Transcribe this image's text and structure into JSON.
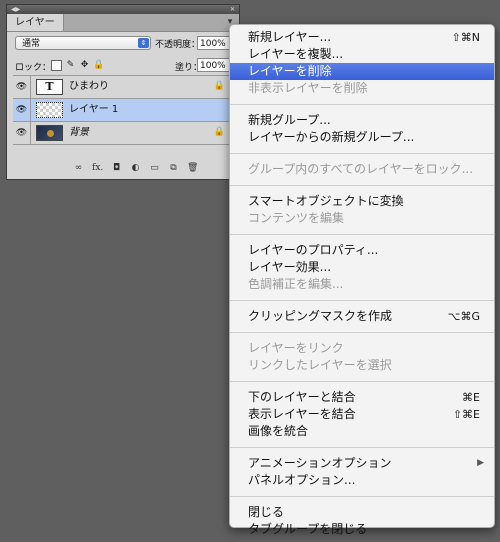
{
  "panel": {
    "tab_label": "レイヤー",
    "menu_button": "▾",
    "blend_mode": "通常",
    "opacity_label": "不透明度：",
    "opacity_value": "100%",
    "lock_label": "ロック：",
    "fill_label": "塗り：",
    "fill_value": "100%",
    "layers": [
      {
        "name": "ひまわり",
        "thumb": "T"
      },
      {
        "name": "レイヤー 1",
        "thumb": ""
      },
      {
        "name": "背景",
        "thumb": ""
      }
    ],
    "footer_fx": "fx."
  },
  "menu": {
    "items": [
      {
        "label": "新規レイヤー...",
        "shortcut": "⇧⌘N"
      },
      {
        "label": "レイヤーを複製..."
      },
      {
        "label": "レイヤーを削除"
      },
      {
        "label": "非表示レイヤーを削除"
      },
      {
        "label": "新規グループ..."
      },
      {
        "label": "レイヤーからの新規グループ..."
      },
      {
        "label": "グループ内のすべてのレイヤーをロック..."
      },
      {
        "label": "スマートオブジェクトに変換"
      },
      {
        "label": "コンテンツを編集"
      },
      {
        "label": "レイヤーのプロパティ..."
      },
      {
        "label": "レイヤー効果..."
      },
      {
        "label": "色調補正を編集..."
      },
      {
        "label": "クリッピングマスクを作成",
        "shortcut": "⌥⌘G"
      },
      {
        "label": "レイヤーをリンク"
      },
      {
        "label": "リンクしたレイヤーを選択"
      },
      {
        "label": "下のレイヤーと結合",
        "shortcut": "⌘E"
      },
      {
        "label": "表示レイヤーを結合",
        "shortcut": "⇧⌘E"
      },
      {
        "label": "画像を統合"
      },
      {
        "label": "アニメーションオプション",
        "submenu": "▶"
      },
      {
        "label": "パネルオプション..."
      },
      {
        "label": "閉じる"
      },
      {
        "label": "タブグループを閉じる"
      }
    ]
  },
  "colors": {
    "highlight": "#3a5fd9",
    "selected_layer": "#b5cdf3"
  }
}
